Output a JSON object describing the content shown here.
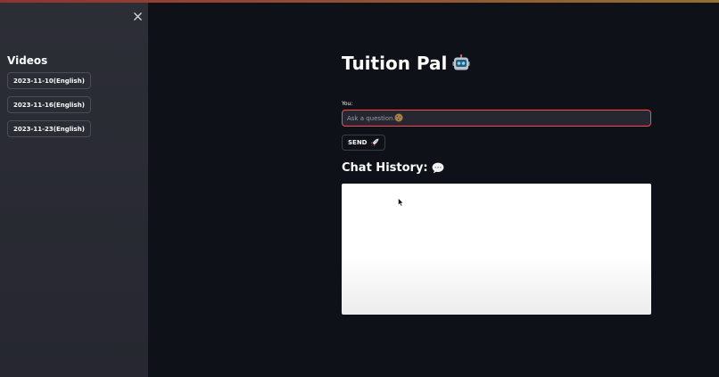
{
  "sidebar": {
    "title": "Videos",
    "videos": [
      {
        "label": "2023-11-10(English)"
      },
      {
        "label": "2023-11-16(English)"
      },
      {
        "label": "2023-11-23(English)"
      }
    ]
  },
  "main": {
    "title": "Tuition Pal",
    "input_label": "You:",
    "input_placeholder": "Ask a question...",
    "input_value": "",
    "send_label": "SEND",
    "chat_heading": "Chat History:"
  },
  "icons": {
    "close": "close-icon",
    "title": "robot-icon",
    "input": "cookie-icon",
    "send": "rocket-icon",
    "chat": "speech-bubble-icon"
  },
  "colors": {
    "background": "#0e1117",
    "sidebar": "#262730",
    "accent": "#ff4b4b",
    "text": "#fafafa"
  }
}
